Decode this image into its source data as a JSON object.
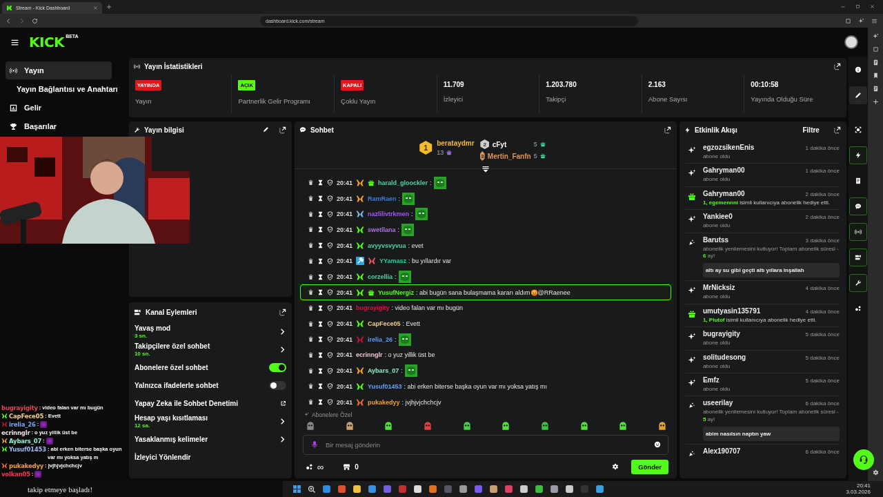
{
  "browser": {
    "tab_title": "Stream - Kick Dashboard",
    "url": "dashboard.kick.com/stream"
  },
  "header": {
    "logo": "KICK",
    "logo_badge": "BETA"
  },
  "nav": [
    {
      "kind": "broadcast",
      "label": "Yayın",
      "selected": true
    },
    {
      "kind": "none",
      "label": "Yayın Bağlantısı ve Anahtarı",
      "selected": false
    },
    {
      "kind": "chart",
      "label": "Gelir",
      "selected": false
    },
    {
      "kind": "trophy",
      "label": "Başarılar",
      "selected": false
    }
  ],
  "stats": {
    "title": "Yayın İstatistikleri",
    "items": [
      {
        "kind": "badge",
        "badge": "YAYINDA",
        "color": "#e0171b",
        "label": "Yayın"
      },
      {
        "kind": "badge",
        "badge": "AÇIK",
        "color": "#53fc18",
        "label": "Partnerlik Gelir Programı"
      },
      {
        "kind": "badge",
        "badge": "KAPALI",
        "color": "#e0171b",
        "label": "Çoklu Yayın"
      },
      {
        "kind": "value",
        "value": "11.709",
        "label": "İzleyici"
      },
      {
        "kind": "value",
        "value": "1.203.780",
        "label": "Takipçi"
      },
      {
        "kind": "value",
        "value": "2.163",
        "label": "Abone Sayısı"
      },
      {
        "kind": "value",
        "value": "00:10:58",
        "label": "Yayında Olduğu Süre"
      }
    ]
  },
  "stream_info": {
    "title": "Yayın bilgisi"
  },
  "channel_actions": {
    "title": "Kanal Eylemleri",
    "items": [
      {
        "kind": "link",
        "label": "Yavaş mod",
        "detail": "3 sn."
      },
      {
        "kind": "link",
        "label": "Takipçilere özel sohbet",
        "detail": "10 sn."
      },
      {
        "kind": "toggle",
        "label": "Abonelere özel sohbet",
        "on": true
      },
      {
        "kind": "toggle",
        "label": "Yalnızca ifadelerle sohbet",
        "on": false
      },
      {
        "kind": "external",
        "label": "Yapay Zeka ile Sohbet Denetimi"
      },
      {
        "kind": "link",
        "label": "Hesap yaşı kısıtlaması",
        "detail": "12 sa."
      },
      {
        "kind": "link",
        "label": "Yasaklanmış kelimeler"
      },
      {
        "kind": "plain",
        "label": "İzleyici Yönlendir"
      }
    ]
  },
  "chat": {
    "title": "Sohbet",
    "leaderboard": [
      {
        "rank": "1",
        "name": "berataydmr",
        "count": "13",
        "color": "#f5b82e"
      },
      {
        "rank": "2",
        "name": "cFyt",
        "count": "5",
        "color": "#cfcfcf"
      },
      {
        "rank": "3",
        "name": "Mertin_Fanfn",
        "count": "5",
        "color": "#e0965a"
      }
    ],
    "messages": [
      {
        "time": "20:41",
        "user": "harald_gloockler",
        "color": "#4fd1a5",
        "badges": [
          {
            "kind": "subscriber",
            "color": "#f0a030"
          },
          {
            "kind": "gift",
            "color": "#53fc18"
          }
        ],
        "emote": true,
        "text": ":",
        "highlighted": false
      },
      {
        "time": "20:41",
        "user": "RamRaen",
        "color": "#3b7ddd",
        "badges": [
          {
            "kind": "subscriber",
            "color": "#f0a030"
          }
        ],
        "emote": true,
        "text": ":",
        "highlighted": false
      },
      {
        "time": "20:41",
        "user": "nazlilivtrkmen",
        "color": "#a855f7",
        "badges": [
          {
            "kind": "subscriber",
            "color": "#7ab8e8"
          }
        ],
        "emote": true,
        "text": ":",
        "highlighted": false
      },
      {
        "time": "20:41",
        "user": "swetllana",
        "color": "#b06ee8",
        "badges": [
          {
            "kind": "subscriber",
            "color": "#53fc18"
          }
        ],
        "emote": true,
        "text": ":",
        "highlighted": false
      },
      {
        "time": "20:41",
        "user": "avyyvsvyvua",
        "color": "#4fd1a5",
        "badges": [
          {
            "kind": "subscriber",
            "color": "#53fc18"
          }
        ],
        "emote": false,
        "text": ": evet",
        "highlighted": false
      },
      {
        "time": "20:41",
        "user": "YYamasz",
        "color": "#2ecc9a",
        "badges": [
          {
            "kind": "hammer",
            "color": "#2aa7e0"
          },
          {
            "kind": "subscriber",
            "color": "#e05a5a"
          }
        ],
        "emote": false,
        "text": ": bu yıllardır var",
        "highlighted": false
      },
      {
        "time": "20:41",
        "user": "corzellia",
        "color": "#4fd1a5",
        "badges": [
          {
            "kind": "subscriber",
            "color": "#53fc18"
          }
        ],
        "emote": true,
        "text": ":",
        "highlighted": false
      },
      {
        "time": "20:41",
        "user": "YusufNergiz",
        "color": "#53fc18",
        "badges": [
          {
            "kind": "subscriber",
            "color": "#53fc18"
          },
          {
            "kind": "gift",
            "color": "#53fc18"
          }
        ],
        "emote": false,
        "text": ": abi bugün sana bulaşmama kararı aldım😡@RRaenee",
        "highlighted": true
      },
      {
        "time": "20:41",
        "user": "bugrayigity",
        "color": "#dc143c",
        "emote": false,
        "text": ": video falan var mı bugün",
        "highlighted": false
      },
      {
        "time": "20:41",
        "user": "CapFece05",
        "color": "#f5d08a",
        "badges": [
          {
            "kind": "subscriber",
            "color": "#53fc18"
          }
        ],
        "emote": false,
        "text": ": Evett",
        "highlighted": false
      },
      {
        "time": "20:41",
        "user": "irelia_26",
        "color": "#5b9bf0",
        "badges": [
          {
            "kind": "subscriber",
            "color": "#c0143c"
          }
        ],
        "emote": true,
        "text": ":",
        "highlighted": false
      },
      {
        "time": "20:41",
        "user": "ecrinnglr",
        "color": "#f0c8d8",
        "emote": false,
        "text": ": o yuz yillik üst be",
        "highlighted": false
      },
      {
        "time": "20:41",
        "user": "Aybars_07",
        "color": "#8ef0d0",
        "badges": [
          {
            "kind": "subscriber",
            "color": "#f0a030"
          }
        ],
        "emote": true,
        "text": ":",
        "highlighted": false
      },
      {
        "time": "20:41",
        "user": "Yusuf01453",
        "color": "#6aa0f5",
        "badges": [
          {
            "kind": "subscriber",
            "color": "#53fc18"
          }
        ],
        "emote": false,
        "text": ": abi erken biterse başka oyun var mı yoksa yatış mı",
        "highlighted": false
      },
      {
        "time": "20:41",
        "user": "pukakedyy",
        "color": "#f0a030",
        "badges": [
          {
            "kind": "subscriber",
            "color": "#f06a30"
          }
        ],
        "emote": false,
        "text": ": jvjhjvjchchcjv",
        "highlighted": false
      }
    ],
    "emote_section": "Abonelere Özel",
    "input_placeholder": "Bir mesaj gönderin",
    "points": "∞",
    "store_count": "0",
    "send_button": "Gönder"
  },
  "activity": {
    "title": "Etkinlik Akışı",
    "filter": "Filtre",
    "items": [
      {
        "kind": "sub",
        "name": "egzozsikenEnis",
        "time": "1 dakika önce",
        "text": "abone oldu"
      },
      {
        "kind": "sub",
        "name": "Gahryman00",
        "time": "1 dakika önce",
        "text": "abone oldu"
      },
      {
        "kind": "gift",
        "name": "Gahryman00",
        "time": "2 dakika önce",
        "recipient": "1, egemennni",
        "text": "isimli kullanıcıya abonelik hediye etti."
      },
      {
        "kind": "sub",
        "name": "Yankiee0",
        "time": "2 dakika önce",
        "text": "abone oldu"
      },
      {
        "kind": "resub",
        "name": "Barutss",
        "time": "3 dakika önce",
        "text": "abonelik yenilemesini kutluyor! Toplam abonelik süresi - **6** ay!",
        "message": "altı ay su gibi geçti altı yıllara inşallah"
      },
      {
        "kind": "sub",
        "name": "MrNicksiz",
        "time": "4 dakika önce",
        "text": "abone oldu"
      },
      {
        "kind": "gift",
        "name": "umutyasin135791",
        "time": "4 dakika önce",
        "recipient": "1, Plutof",
        "text": "isimli kullanıcıya abonelik hediye etti."
      },
      {
        "kind": "sub",
        "name": "bugrayigity",
        "time": "5 dakika önce",
        "text": "abone oldu"
      },
      {
        "kind": "sub",
        "name": "solitudesong",
        "time": "5 dakika önce",
        "text": "abone oldu"
      },
      {
        "kind": "sub",
        "name": "Emfz",
        "time": "5 dakika önce",
        "text": "abone oldu"
      },
      {
        "kind": "resub",
        "name": "useerilay",
        "time": "6 dakika önce",
        "text": "abonelik yenilemesini kutluyor! Toplam abonelik süresi - **5** ay!",
        "message": "abim nasılsın naptın yaw"
      },
      {
        "kind": "resub",
        "name": "Alex190707",
        "time": "6 dakika önce"
      }
    ]
  },
  "tool_rail": [
    {
      "kind": "info",
      "selected": false
    },
    {
      "kind": "edit",
      "selected": false
    },
    {
      "kind": "focus",
      "selected": false
    },
    {
      "kind": "activity",
      "selected": true
    },
    {
      "kind": "notes",
      "selected": false
    },
    {
      "kind": "chat",
      "selected": true
    },
    {
      "kind": "broadcast",
      "selected": true
    },
    {
      "kind": "actions",
      "selected": true
    },
    {
      "kind": "wrench",
      "selected": true
    },
    {
      "kind": "dots",
      "selected": false
    }
  ],
  "overlay_chat": [
    {
      "user": "bugrayigity",
      "color": "#e0455a",
      "text": ": video falan var mı bugün"
    },
    {
      "user": "CapFece05",
      "color": "#f5d08a",
      "badges": [
        {
          "kind": "subscriber",
          "color": "#53fc18"
        }
      ],
      "text": ": Evett"
    },
    {
      "user": "irelia_26",
      "color": "#7aa2f7",
      "badges": [
        {
          "kind": "subscriber",
          "color": "#c0143c"
        }
      ],
      "text": ":",
      "emote": true
    },
    {
      "user": "ecrinnglr",
      "color": "#f0e0e8",
      "text": ": o yuz yillik üst be"
    },
    {
      "user": "Aybars_07",
      "color": "#8ef0d0",
      "badges": [
        {
          "kind": "subscriber",
          "color": "#f0a030"
        }
      ],
      "text": ":",
      "emote": true
    },
    {
      "user": "Yusuf01453",
      "color": "#9fb8f0",
      "badges": [
        {
          "kind": "subscriber",
          "color": "#53fc18"
        }
      ],
      "text": ": abi erken biterse başka oyun var mı yoksa yatış m"
    },
    {
      "user": "pukakedyy",
      "color": "#f0a030",
      "badges": [
        {
          "kind": "subscriber",
          "color": "#f06a30"
        }
      ],
      "text": ": jvjhjvjchchcjv"
    },
    {
      "user": "volkan05",
      "color": "#ff3355",
      "text": ":",
      "emote": true
    }
  ],
  "follow_alert": "takip etmeye başladı!",
  "taskbar": {
    "time": "20:41",
    "date": "3.03.2026"
  }
}
